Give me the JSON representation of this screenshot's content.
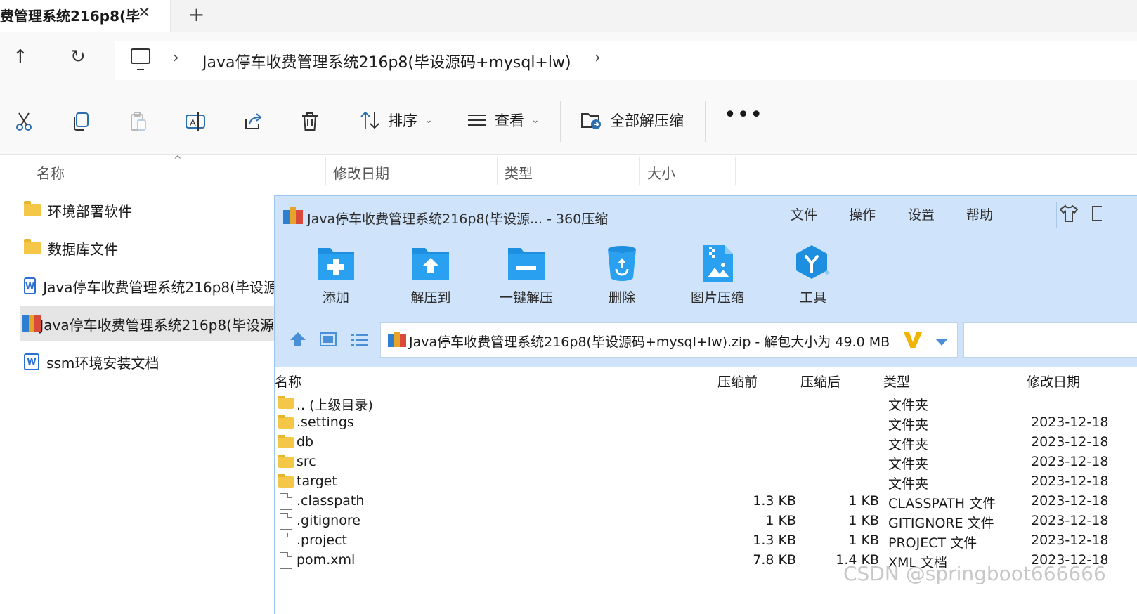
{
  "tab": {
    "title": "费管理系统216p8(毕",
    "close": "✕",
    "new": "+"
  },
  "nav": {
    "up": "↑",
    "refresh": "↻",
    "sep1": "›",
    "sep2": "›",
    "path": "Java停车收费管理系统216p8(毕设源码+mysql+lw)"
  },
  "toolbar": {
    "sort_label": "排序",
    "view_label": "查看",
    "extract_all_label": "全部解压缩",
    "more": "•••",
    "chevron": "⌄"
  },
  "columns": {
    "name": "名称",
    "modified": "修改日期",
    "type": "类型",
    "size": "大小",
    "sort_caret": "^"
  },
  "files": [
    {
      "label": "环境部署软件",
      "icon": "folder-icon"
    },
    {
      "label": "数据库文件",
      "icon": "folder-icon"
    },
    {
      "label": "Java停车收费管理系统216p8(毕设源",
      "icon": "word-doc-icon"
    },
    {
      "label": "Java停车收费管理系统216p8(毕设源",
      "icon": "zip-archive-icon",
      "selected": true
    },
    {
      "label": "ssm环境安装文档",
      "icon": "word-doc-icon"
    }
  ],
  "zip": {
    "title": "Java停车收费管理系统216p8(毕设源... - 360压缩",
    "menu": [
      "文件",
      "操作",
      "设置",
      "帮助"
    ],
    "actions": [
      "添加",
      "解压到",
      "一键解压",
      "删除",
      "图片压缩",
      "工具"
    ],
    "path": "Java停车收费管理系统216p8(毕设源码+mysql+lw).zip - 解包大小为 49.0 MB",
    "headers": {
      "name": "名称",
      "before": "压缩前",
      "after": "压缩后",
      "type": "类型",
      "date": "修改日期"
    },
    "rows": [
      {
        "name": ".. (上级目录)",
        "before": "",
        "after": "",
        "type": "文件夹",
        "date": "",
        "kind": "folder"
      },
      {
        "name": ".settings",
        "before": "",
        "after": "",
        "type": "文件夹",
        "date": "2023-12-18",
        "kind": "folder"
      },
      {
        "name": "db",
        "before": "",
        "after": "",
        "type": "文件夹",
        "date": "2023-12-18",
        "kind": "folder"
      },
      {
        "name": "src",
        "before": "",
        "after": "",
        "type": "文件夹",
        "date": "2023-12-18",
        "kind": "folder"
      },
      {
        "name": "target",
        "before": "",
        "after": "",
        "type": "文件夹",
        "date": "2023-12-18",
        "kind": "folder"
      },
      {
        "name": ".classpath",
        "before": "1.3 KB",
        "after": "1 KB",
        "type": "CLASSPATH 文件",
        "date": "2023-12-18",
        "kind": "file"
      },
      {
        "name": ".gitignore",
        "before": "1 KB",
        "after": "1 KB",
        "type": "GITIGNORE 文件",
        "date": "2023-12-18",
        "kind": "file"
      },
      {
        "name": ".project",
        "before": "1.3 KB",
        "after": "1 KB",
        "type": "PROJECT 文件",
        "date": "2023-12-18",
        "kind": "file"
      },
      {
        "name": "pom.xml",
        "before": "7.8 KB",
        "after": "1.4 KB",
        "type": "XML 文档",
        "date": "2023-12-18",
        "kind": "file"
      }
    ]
  },
  "watermark": "CSDN @springboot666666",
  "colors": {
    "zip_header_bg": "#cfe4fb",
    "zip_icon_blue": "#1e8fe0",
    "selected_row": "#e5e5e5",
    "folder": "#f4c748"
  }
}
